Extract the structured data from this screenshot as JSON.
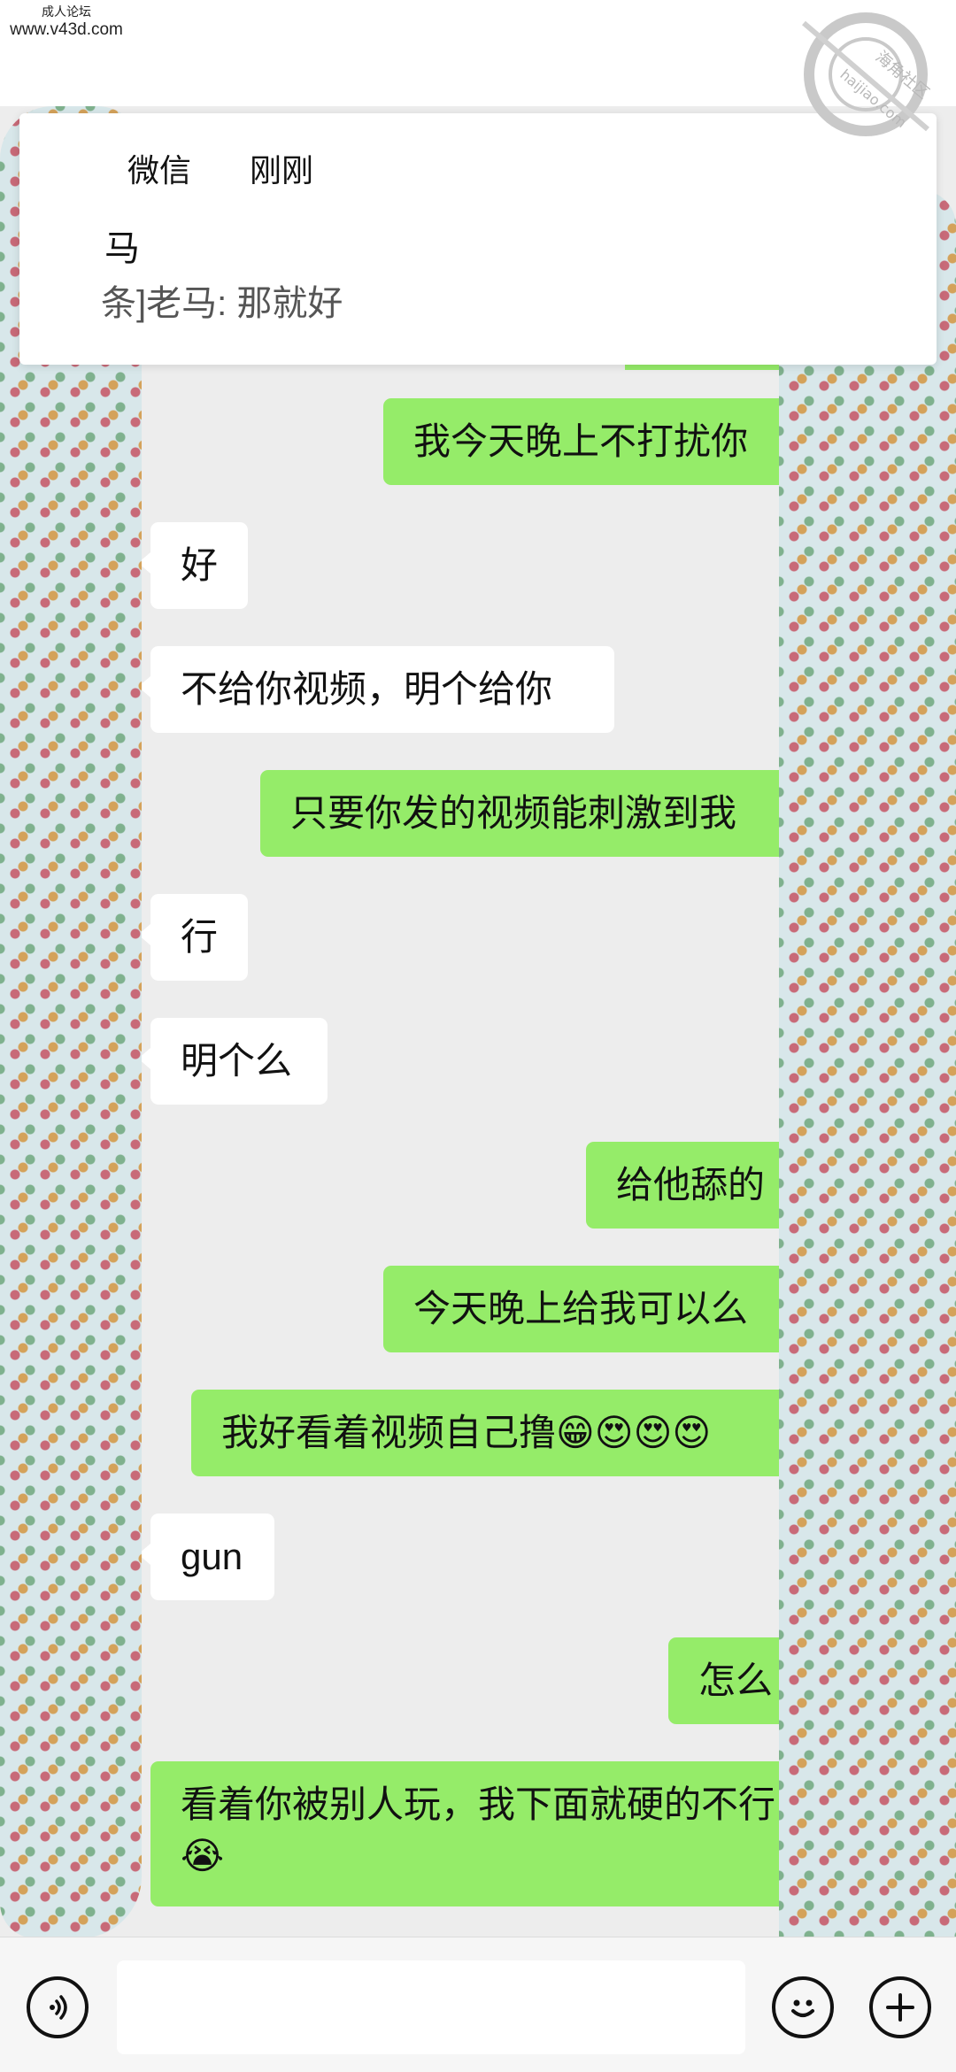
{
  "watermark": {
    "line1": "成人论坛",
    "line2": "www.v43d.com",
    "stamp_cn": "海角社区",
    "stamp_en": "haijiao.com"
  },
  "notification": {
    "app": "微信",
    "time": "刚刚",
    "sender": "马",
    "preview": "条]老马: 那就好"
  },
  "messages": [
    {
      "side": "out",
      "text": "我今天晚上不打扰你"
    },
    {
      "side": "in",
      "text": "好"
    },
    {
      "side": "in",
      "text": "不给你视频，明个给你"
    },
    {
      "side": "out",
      "text": "只要你发的视频能刺激到我"
    },
    {
      "side": "in",
      "text": "行"
    },
    {
      "side": "in",
      "text": "明个么"
    },
    {
      "side": "out",
      "text": "给他舔的"
    },
    {
      "side": "out",
      "text": "今天晚上给我可以么"
    },
    {
      "side": "out",
      "text": "我好看着视频自己撸😁😍😍😍"
    },
    {
      "side": "in",
      "text": "gun"
    },
    {
      "side": "out",
      "text": "怎么"
    },
    {
      "side": "out",
      "text": "看着你被别人玩，我下面就硬的不行😭"
    }
  ],
  "input": {
    "voice_icon": "voice-icon",
    "emoji_icon": "emoji-icon",
    "plus_icon": "plus-icon",
    "placeholder": ""
  },
  "colors": {
    "background": "#ededed",
    "outgoing_bubble": "#95ec69",
    "incoming_bubble": "#ffffff"
  }
}
